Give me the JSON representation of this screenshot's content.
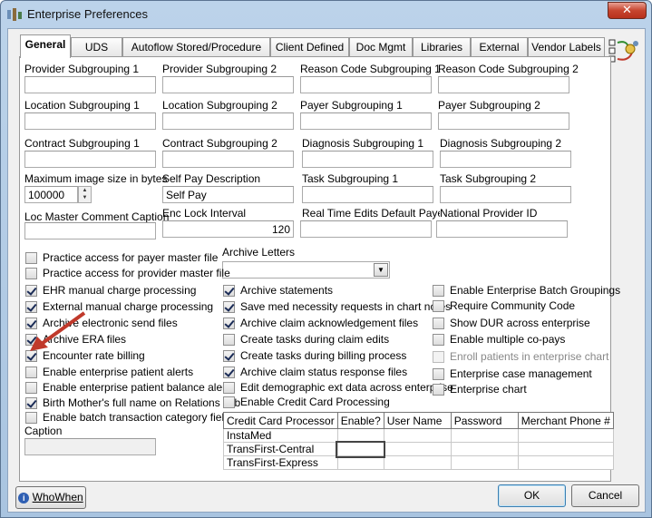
{
  "window": {
    "title": "Enterprise Preferences",
    "close_label": "✕"
  },
  "tabs": [
    "General",
    "UDS",
    "Autoflow Stored/Procedure",
    "Client Defined",
    "Doc Mgmt",
    "Libraries",
    "External",
    "Vendor Labels"
  ],
  "rows": {
    "r1": [
      {
        "label": "Provider Subgrouping 1",
        "value": ""
      },
      {
        "label": "Provider Subgrouping 2",
        "value": ""
      },
      {
        "label": "Reason Code Subgrouping 1",
        "value": ""
      },
      {
        "label": "Reason Code Subgrouping 2",
        "value": ""
      }
    ],
    "r2": [
      {
        "label": "Location Subgrouping 1",
        "value": ""
      },
      {
        "label": "Location Subgrouping 2",
        "value": ""
      },
      {
        "label": "Payer Subgrouping 1",
        "value": ""
      },
      {
        "label": "Payer Subgrouping 2",
        "value": ""
      }
    ],
    "r3": [
      {
        "label": "Contract Subgrouping 1",
        "value": ""
      },
      {
        "label": "Contract Subgrouping 2",
        "value": ""
      },
      {
        "label": "Diagnosis Subgrouping 1",
        "value": ""
      },
      {
        "label": "Diagnosis Subgrouping 2",
        "value": ""
      }
    ],
    "r4": [
      {
        "label": "Maximum image size in bytes",
        "value": "100000"
      },
      {
        "label": "Self Pay Description",
        "value": "Self Pay"
      },
      {
        "label": "Task Subgrouping 1",
        "value": ""
      },
      {
        "label": "Task Subgrouping 2",
        "value": ""
      }
    ],
    "r5": [
      {
        "label": "Loc Master Comment Caption",
        "value": ""
      },
      {
        "label": "Enc Lock Interval",
        "value": "120"
      },
      {
        "label": "Real Time Edits Default Payer ID",
        "value": ""
      },
      {
        "label": "National Provider ID",
        "value": ""
      }
    ]
  },
  "archive_letters": {
    "label": "Archive Letters",
    "value": ""
  },
  "col1": [
    {
      "label": "Practice access for payer master file",
      "checked": false
    },
    {
      "label": "Practice access for provider master file",
      "checked": false
    },
    {
      "label": "EHR manual charge processing",
      "checked": true
    },
    {
      "label": "External manual charge processing",
      "checked": true
    },
    {
      "label": "Archive electronic send files",
      "checked": true
    },
    {
      "label": "Archive ERA files",
      "checked": true
    },
    {
      "label": "Encounter rate billing",
      "checked": true
    },
    {
      "label": "Enable enterprise patient alerts",
      "checked": false
    },
    {
      "label": "Enable enterprise patient balance alerts",
      "checked": false
    },
    {
      "label": "Birth Mother's full name on Relations Tab",
      "checked": true
    },
    {
      "label": "Enable batch transaction category field",
      "checked": false
    }
  ],
  "caption": {
    "label": "Caption",
    "value": ""
  },
  "col2": [
    {
      "label": "Archive statements",
      "checked": true
    },
    {
      "label": "Save med necessity requests in chart notes",
      "checked": true
    },
    {
      "label": "Archive claim acknowledgement files",
      "checked": true
    },
    {
      "label": "Create tasks during claim edits",
      "checked": false
    },
    {
      "label": "Create tasks during billing process",
      "checked": true
    },
    {
      "label": "Archive claim status response files",
      "checked": true
    },
    {
      "label": "Edit demographic ext data across enterprise",
      "checked": false
    },
    {
      "label": "Enable Credit Card Processing",
      "checked": false
    }
  ],
  "col3": [
    {
      "label": "Enable Enterprise Batch Groupings",
      "checked": false,
      "disabled": false
    },
    {
      "label": "Require Community Code",
      "checked": false,
      "disabled": false
    },
    {
      "label": "Show DUR across enterprise",
      "checked": false,
      "disabled": false
    },
    {
      "label": "Enable multiple co-pays",
      "checked": false,
      "disabled": false
    },
    {
      "label": "Enroll patients in enterprise chart",
      "checked": false,
      "disabled": true
    },
    {
      "label": "Enterprise case management",
      "checked": false,
      "disabled": false
    },
    {
      "label": "Enterprise chart",
      "checked": false,
      "disabled": false
    }
  ],
  "cc_table": {
    "headers": [
      "Credit Card Processor",
      "Enable?",
      "User Name",
      "Password",
      "Merchant Phone #"
    ],
    "rows": [
      [
        "InstaMed",
        "",
        "",
        "",
        ""
      ],
      [
        "TransFirst-Central",
        "",
        "",
        "",
        ""
      ],
      [
        "TransFirst-Express",
        "",
        "",
        "",
        ""
      ]
    ]
  },
  "buttons": {
    "who_when": "WhoWhen",
    "ok": "OK",
    "cancel": "Cancel"
  },
  "colors": {
    "accent_arrow": "#c0392b"
  }
}
